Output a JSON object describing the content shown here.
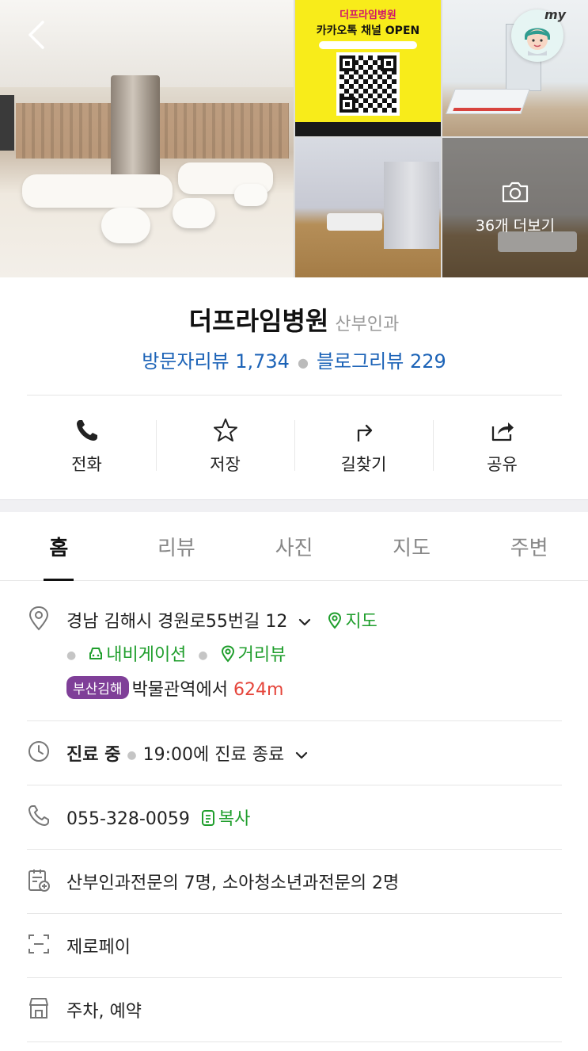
{
  "header": {
    "more_photos_label": "36개 더보기",
    "my_label": "my",
    "qr_poster": {
      "title": "더프라임병원",
      "subtitle": "카카오톡 채널 OPEN"
    }
  },
  "place": {
    "name": "더프라임병원",
    "category": "산부인과",
    "visitor_reviews": "방문자리뷰 1,734",
    "blog_reviews": "블로그리뷰 229"
  },
  "actions": [
    {
      "label": "전화",
      "icon": "phone-icon"
    },
    {
      "label": "저장",
      "icon": "star-icon"
    },
    {
      "label": "길찾기",
      "icon": "directions-icon"
    },
    {
      "label": "공유",
      "icon": "share-icon"
    }
  ],
  "tabs": [
    {
      "label": "홈",
      "active": true
    },
    {
      "label": "리뷰",
      "active": false
    },
    {
      "label": "사진",
      "active": false
    },
    {
      "label": "지도",
      "active": false
    },
    {
      "label": "주변",
      "active": false
    }
  ],
  "info": {
    "address": "경남 김해시 경원로55번길 12",
    "map_link": "지도",
    "navigation_link": "내비게이션",
    "street_view_link": "거리뷰",
    "subway_line": "부산김해",
    "station": "박물관역",
    "station_suffix": "에서",
    "distance": "624m",
    "status": "진료 중",
    "hours": "19:00에 진료 종료",
    "phone": "055-328-0059",
    "copy_label": "복사",
    "doctors": "산부인과전문의 7명, 소아청소년과전문의 2명",
    "payment": "제로페이",
    "facilities": "주차, 예약"
  },
  "colors": {
    "link_blue": "#1c63b7",
    "link_green": "#1f9e2c",
    "distance_red": "#e5453b",
    "subway_purple": "#7f3f98"
  }
}
